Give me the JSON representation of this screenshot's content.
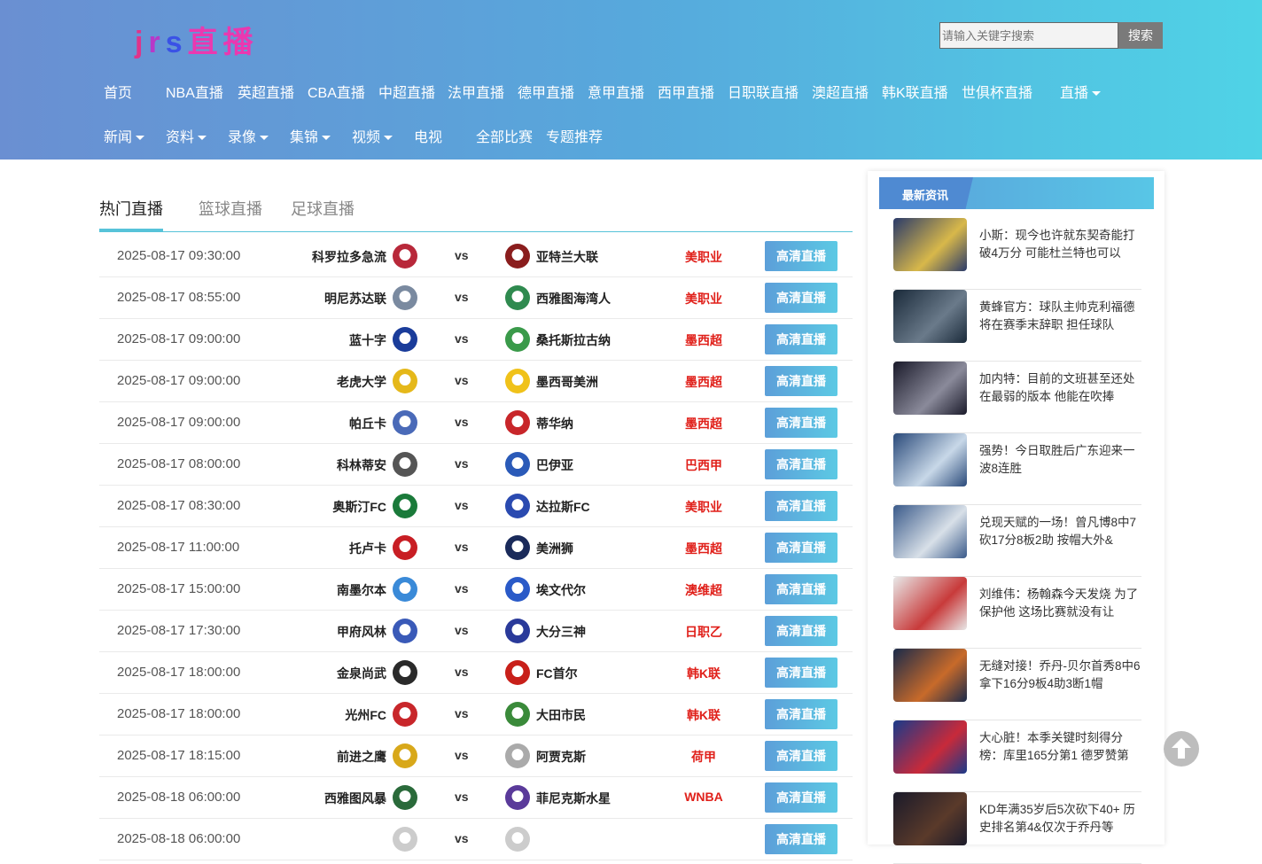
{
  "header": {
    "logo": {
      "p1": "j",
      "p2": "r",
      "p3": "s",
      "p4": "直播"
    },
    "search": {
      "placeholder": "请输入关键字搜索",
      "button": "搜索"
    },
    "nav_main": [
      {
        "label": "首页"
      },
      {
        "label": "NBA直播"
      },
      {
        "label": "英超直播"
      },
      {
        "label": "CBA直播"
      },
      {
        "label": "中超直播"
      },
      {
        "label": "法甲直播"
      },
      {
        "label": "德甲直播"
      },
      {
        "label": "意甲直播"
      },
      {
        "label": "西甲直播"
      },
      {
        "label": "日职联直播"
      },
      {
        "label": "澳超直播"
      },
      {
        "label": "韩K联直播"
      },
      {
        "label": "世俱杯直播"
      },
      {
        "label": "直播"
      }
    ],
    "nav_sub": [
      {
        "label": "新闻"
      },
      {
        "label": "资料"
      },
      {
        "label": "录像"
      },
      {
        "label": "集锦"
      },
      {
        "label": "视频"
      },
      {
        "label": "电视"
      },
      {
        "label": "全部比赛"
      },
      {
        "label": "专题推荐"
      }
    ]
  },
  "tabs": [
    {
      "label": "热门直播"
    },
    {
      "label": "篮球直播"
    },
    {
      "label": "足球直播"
    }
  ],
  "live_button_label": "高清直播",
  "vs_label": "vs",
  "matches": [
    {
      "time": "2025-08-17 09:30:00",
      "home": "科罗拉多急流",
      "away": "亚特兰大联",
      "league": "美职业",
      "hcolor": "#b8283a",
      "acolor": "#8a1d1d"
    },
    {
      "time": "2025-08-17 08:55:00",
      "home": "明尼苏达联",
      "away": "西雅图海湾人",
      "league": "美职业",
      "hcolor": "#7a8aa0",
      "acolor": "#2f8a4f"
    },
    {
      "time": "2025-08-17 09:00:00",
      "home": "蓝十字",
      "away": "桑托斯拉古纳",
      "league": "墨西超",
      "hcolor": "#1a3c9a",
      "acolor": "#3a9a4a"
    },
    {
      "time": "2025-08-17 09:00:00",
      "home": "老虎大学",
      "away": "墨西哥美洲",
      "league": "墨西超",
      "hcolor": "#e5b81a",
      "acolor": "#f0c21a"
    },
    {
      "time": "2025-08-17 09:00:00",
      "home": "帕丘卡",
      "away": "蒂华纳",
      "league": "墨西超",
      "hcolor": "#4a6ab8",
      "acolor": "#c8262a"
    },
    {
      "time": "2025-08-17 08:00:00",
      "home": "科林蒂安",
      "away": "巴伊亚",
      "league": "巴西甲",
      "hcolor": "#555555",
      "acolor": "#2a5ab8"
    },
    {
      "time": "2025-08-17 08:30:00",
      "home": "奥斯汀FC",
      "away": "达拉斯FC",
      "league": "美职业",
      "hcolor": "#1a7a3a",
      "acolor": "#2a4ab0"
    },
    {
      "time": "2025-08-17 11:00:00",
      "home": "托卢卡",
      "away": "美洲狮",
      "league": "墨西超",
      "hcolor": "#c81e24",
      "acolor": "#1a2a5a"
    },
    {
      "time": "2025-08-17 15:00:00",
      "home": "南墨尔本",
      "away": "埃文代尔",
      "league": "澳维超",
      "hcolor": "#3a8ad8",
      "acolor": "#2a5ac8"
    },
    {
      "time": "2025-08-17 17:30:00",
      "home": "甲府风林",
      "away": "大分三神",
      "league": "日职乙",
      "hcolor": "#3a5ab8",
      "acolor": "#2a3a9a"
    },
    {
      "time": "2025-08-17 18:00:00",
      "home": "金泉尚武",
      "away": "FC首尔",
      "league": "韩K联",
      "hcolor": "#2a2a2a",
      "acolor": "#c8201a"
    },
    {
      "time": "2025-08-17 18:00:00",
      "home": "光州FC",
      "away": "大田市民",
      "league": "韩K联",
      "hcolor": "#c8262a",
      "acolor": "#3a8a3a"
    },
    {
      "time": "2025-08-17 18:15:00",
      "home": "前进之鹰",
      "away": "阿贾克斯",
      "league": "荷甲",
      "hcolor": "#d8a81a",
      "acolor": "#aaaaaa"
    },
    {
      "time": "2025-08-18 06:00:00",
      "home": "西雅图风暴",
      "away": "菲尼克斯水星",
      "league": "WNBA",
      "hcolor": "#2a6a3a",
      "acolor": "#5a3a9a"
    },
    {
      "time": "2025-08-18 06:00:00",
      "home": "",
      "away": "",
      "league": "",
      "hcolor": "#cccccc",
      "acolor": "#cccccc"
    }
  ],
  "sidebar": {
    "title": "最新资讯",
    "news": [
      {
        "text": "小斯：现今也许就东契奇能打破4万分 可能杜兰特也可以",
        "c1": "#2a3a6a",
        "c2": "#d8b84a"
      },
      {
        "text": "黄蜂官方：球队主帅克利福德将在赛季末辞职 担任球队",
        "c1": "#1a2a3a",
        "c2": "#6a7a8a"
      },
      {
        "text": "加内特：目前的文班甚至还处在最弱的版本 他能在吹捧",
        "c1": "#1a1a2a",
        "c2": "#8a8a9a"
      },
      {
        "text": "强势！今日取胜后广东迎来一波8连胜",
        "c1": "#2a4a7a",
        "c2": "#c8d8e8"
      },
      {
        "text": "兑现天赋的一场！曾凡博8中7砍17分8板2助 按帽大外&",
        "c1": "#3a5a8a",
        "c2": "#d8e0e8"
      },
      {
        "text": "刘维伟：杨翰森今天发烧 为了保护他 这场比赛就没有让",
        "c1": "#e8e8e8",
        "c2": "#c83a3a"
      },
      {
        "text": "无缝对接！乔丹-贝尔首秀8中6 拿下16分9板4助3断1帽",
        "c1": "#1a2a4a",
        "c2": "#c86a2a"
      },
      {
        "text": "大心脏！本季关键时刻得分榜：库里165分第1 德罗赞第",
        "c1": "#1a3a8a",
        "c2": "#c82a3a"
      },
      {
        "text": "KD年满35岁后5次砍下40+ 历史排名第4&仅次于乔丹等",
        "c1": "#1a1a2a",
        "c2": "#5a3a2a"
      }
    ]
  }
}
